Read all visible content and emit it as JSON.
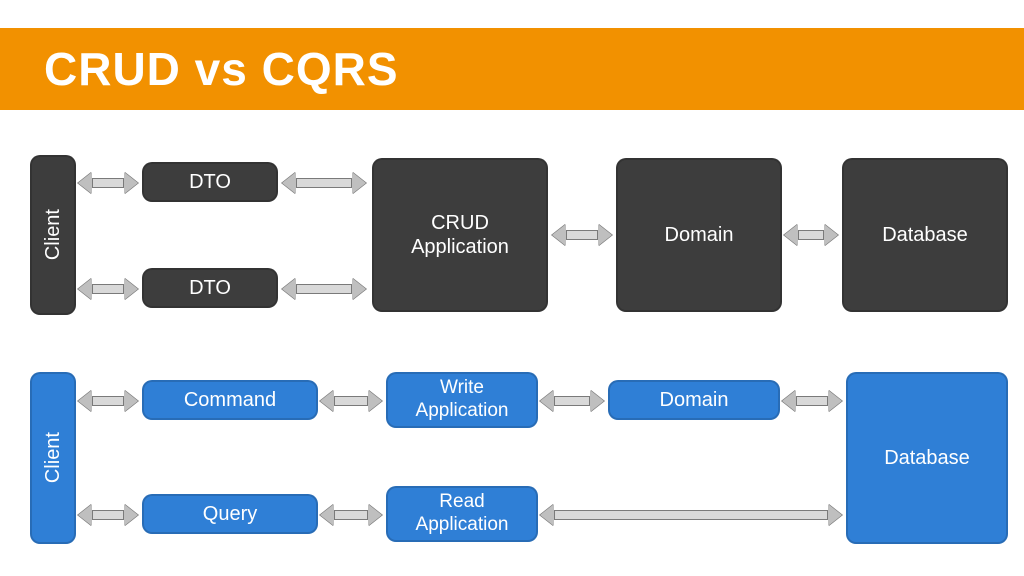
{
  "title": "CRUD vs CQRS",
  "crud": {
    "client": "Client",
    "dto1": "DTO",
    "dto2": "DTO",
    "app": "CRUD\nApplication",
    "domain": "Domain",
    "database": "Database"
  },
  "cqrs": {
    "client": "Client",
    "command": "Command",
    "query": "Query",
    "writeApp": "Write\nApplication",
    "readApp": "Read\nApplication",
    "domain": "Domain",
    "database": "Database"
  }
}
